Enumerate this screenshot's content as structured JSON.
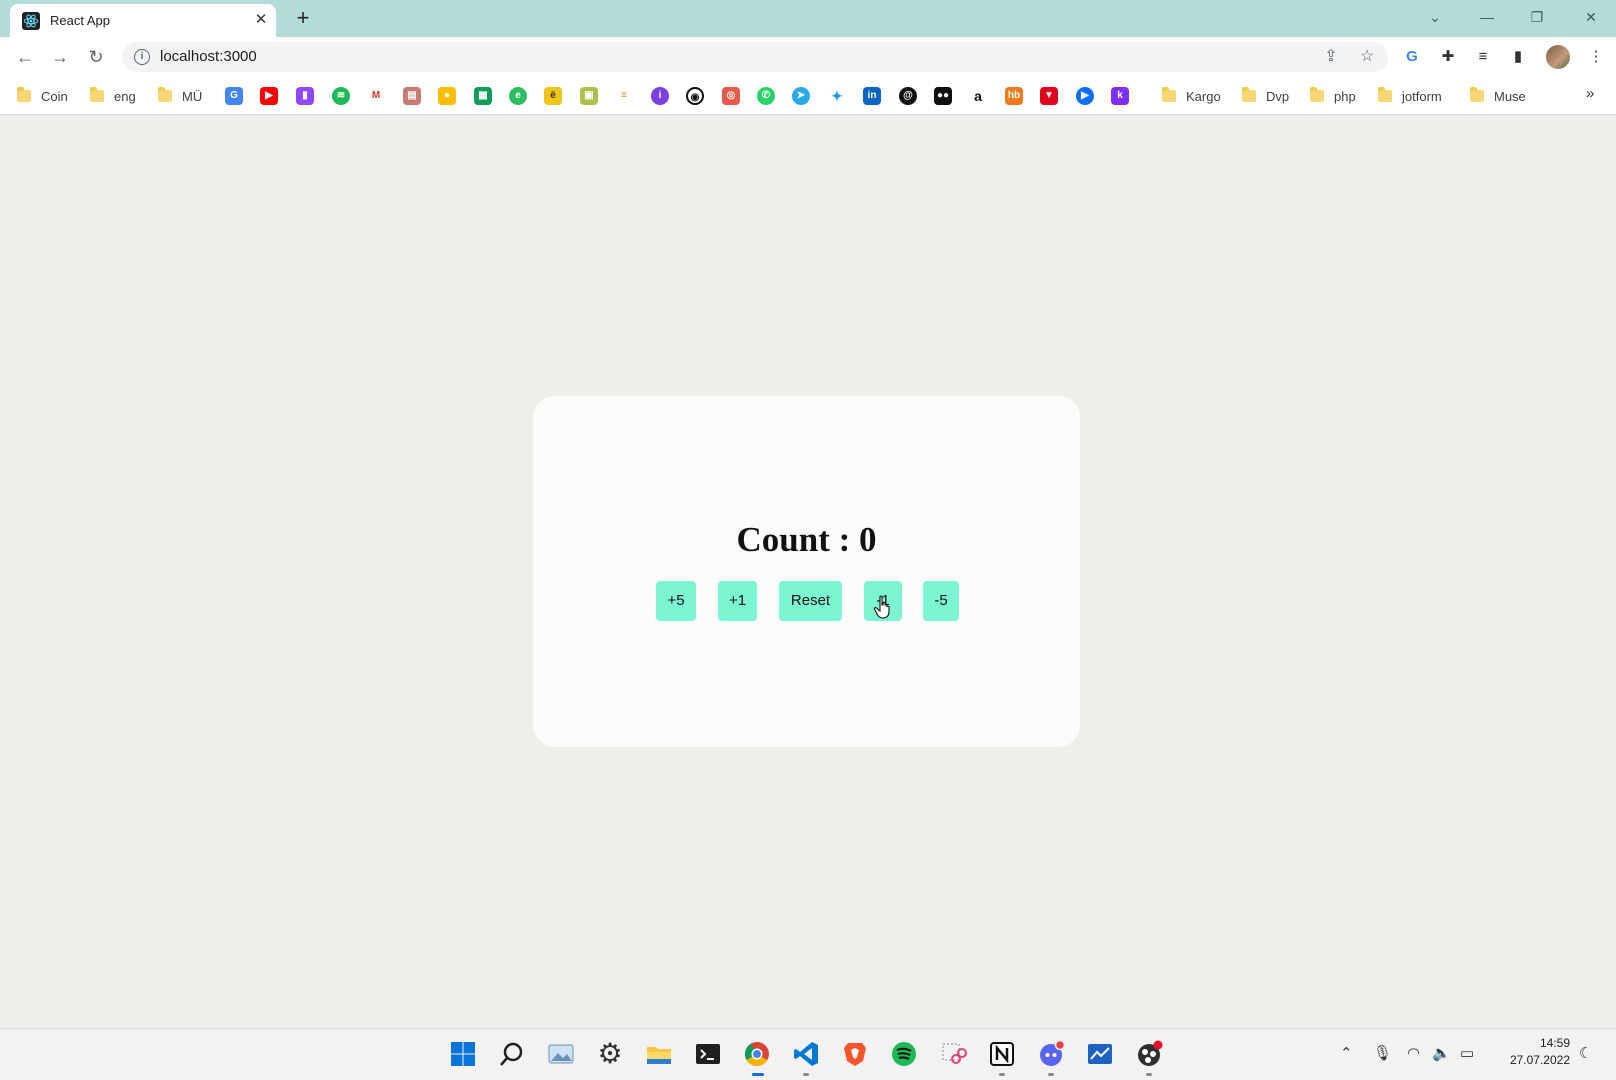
{
  "browser": {
    "tab_title": "React App",
    "url": "localhost:3000",
    "bookmarks": {
      "coin": "Coin",
      "eng": "eng",
      "mu": "MÜ",
      "kargo": "Kargo",
      "dvp": "Dvp",
      "php": "php",
      "jotform": "jotform",
      "muse": "Muse"
    }
  },
  "app": {
    "count_text": "Count : 0",
    "buttons": {
      "plus5": "+5",
      "plus1": "+1",
      "reset": "Reset",
      "minus1": "-1",
      "minus5": "-5"
    },
    "button_color": "#7cf5d3"
  },
  "taskbar": {
    "time": "14:59",
    "date": "27.07.2022"
  }
}
